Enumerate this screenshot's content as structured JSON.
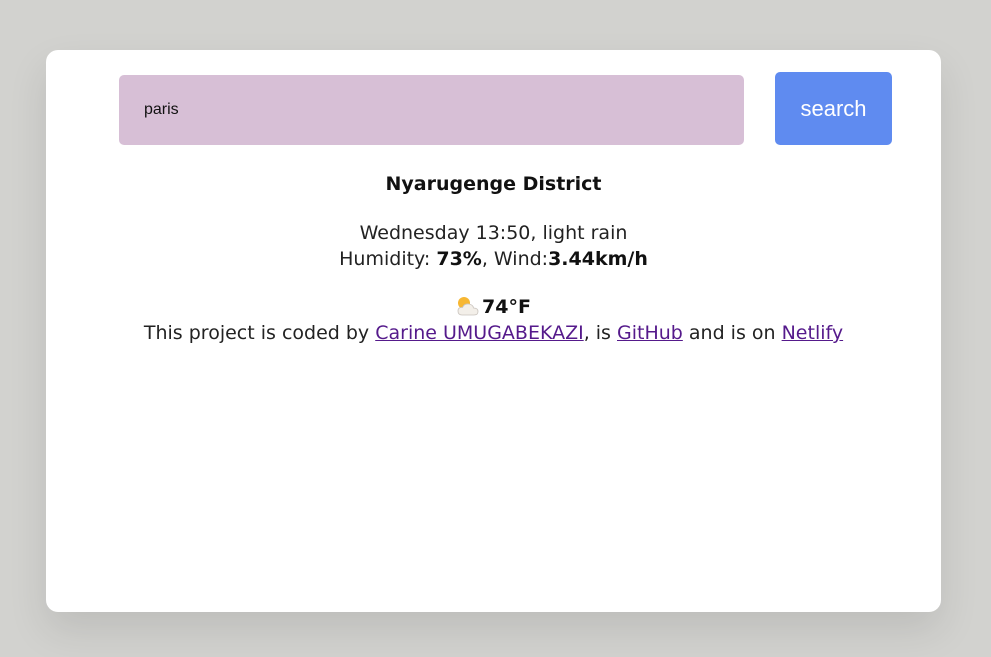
{
  "search": {
    "value": "paris",
    "button_label": "search"
  },
  "weather": {
    "city": "Nyarugenge District",
    "datetime_description": "Wednesday 13:50, light rain",
    "humidity_label": "Humidity: ",
    "humidity_value": "73%",
    "wind_label": ", Wind:",
    "wind_value": "3.44km/h",
    "icon": "partly-cloudy-sun-icon",
    "temperature": "74",
    "unit": "°F"
  },
  "credits": {
    "prefix": "This project is coded by ",
    "author_link": "Carine UMUGABEKAZI",
    "middle": ", is ",
    "github_link": "GitHub",
    "between": " and is on ",
    "netlify_link": "Netlify"
  },
  "colors": {
    "page_background": "#d2d2cf",
    "input_background": "#d7bfd6",
    "button_background": "#5f8bf0",
    "visited_link": "#551a8b"
  }
}
